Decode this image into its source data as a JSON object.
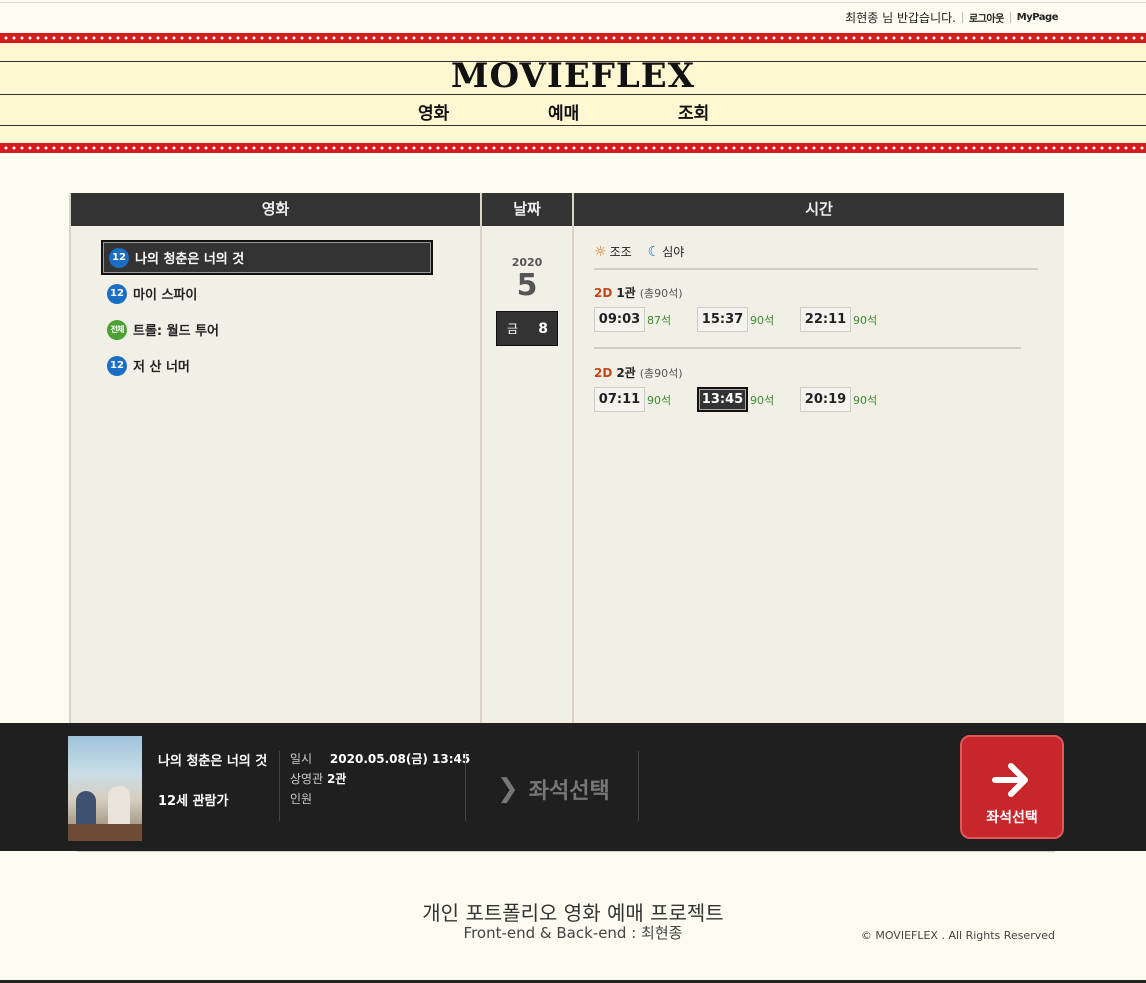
{
  "user_bar": {
    "greeting": "최현종 님 반갑습니다.",
    "logout": "로그아웃",
    "mypage": "MyPage"
  },
  "logo": "MOVIEFLEX",
  "nav": [
    "영화",
    "예매",
    "조회"
  ],
  "columns": {
    "movie": "영화",
    "date": "날짜",
    "time": "시간"
  },
  "movies": [
    {
      "rating": "12",
      "title": "나의 청춘은 너의 것",
      "selected": true
    },
    {
      "rating": "12",
      "title": "마이 스파이",
      "selected": false
    },
    {
      "rating": "전체",
      "title": "트롤: 월드 투어",
      "selected": false
    },
    {
      "rating": "12",
      "title": "저 산 너머",
      "selected": false
    }
  ],
  "date": {
    "year": "2020",
    "month": "5",
    "weekday": "금",
    "day": "8"
  },
  "legend": {
    "morning": "조조",
    "night": "심야"
  },
  "halls": [
    {
      "format": "2D",
      "name": "1관",
      "total": "(총90석)",
      "slots": [
        {
          "time": "09:03",
          "seats": "87석",
          "selected": false
        },
        {
          "time": "15:37",
          "seats": "90석",
          "selected": false
        },
        {
          "time": "22:11",
          "seats": "90석",
          "selected": false
        }
      ]
    },
    {
      "format": "2D",
      "name": "2관",
      "total": "(총90석)",
      "slots": [
        {
          "time": "07:11",
          "seats": "90석",
          "selected": false
        },
        {
          "time": "13:45",
          "seats": "90석",
          "selected": true
        },
        {
          "time": "20:19",
          "seats": "90석",
          "selected": false
        }
      ]
    }
  ],
  "summary": {
    "movie_title": "나의 청춘은 너의 것",
    "rating_text": "12세 관람가",
    "date_label": "일시",
    "date_value": "2020.05.08(금) 13:45",
    "hall_label": "상영관",
    "hall_value": "2관",
    "people_label": "인원",
    "step_label": "좌석선택",
    "button_label": "좌석선택"
  },
  "footer": {
    "title": "개인 포트폴리오 영화 예매 프로젝트",
    "subtitle": "Front-end & Back-end : 최현종",
    "copyright": "© MOVIEFLEX . All Rights Reserved"
  },
  "colors": {
    "header_stripe": "#d51c1c",
    "cream_band": "#fff7d1",
    "dark": "#333333",
    "accent_red": "#c7262a",
    "rating_12": "#1a6fc3",
    "rating_all": "#4aa134",
    "seats_green": "#3a8a32",
    "format_orange": "#c0481d"
  },
  "icons": {
    "morning": "sun-icon",
    "night": "moon-icon",
    "next_step": "chevron-right-icon",
    "seat_button": "arrow-right-icon"
  }
}
